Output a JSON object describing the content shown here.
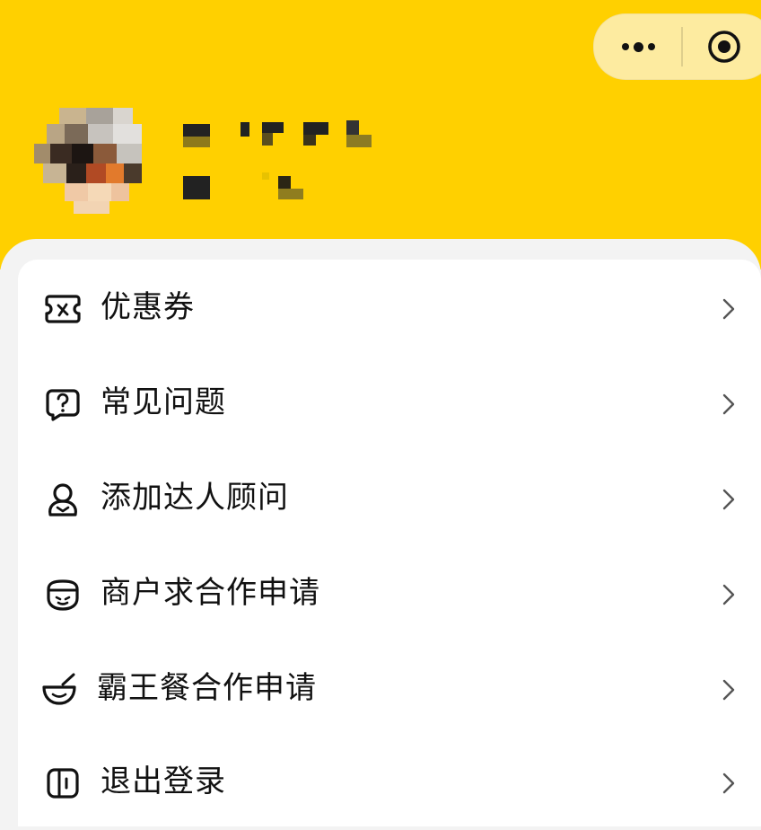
{
  "header": {
    "background_color": "#ffd000",
    "capsule": {
      "more_icon": "more-dots-icon",
      "close_icon": "target-close-icon"
    },
    "avatar_icon": "user-avatar-pixelated",
    "name_redacted": true
  },
  "menu": {
    "items": [
      {
        "label": "优惠券",
        "icon": "coupon-icon"
      },
      {
        "label": "常见问题",
        "icon": "question-bubble-icon"
      },
      {
        "label": "添加达人顾问",
        "icon": "advisor-person-icon"
      },
      {
        "label": "商户求合作申请",
        "icon": "merchant-face-icon"
      },
      {
        "label": "霸王餐合作申请",
        "icon": "meal-bowl-icon"
      },
      {
        "label": "退出登录",
        "icon": "logout-icon"
      }
    ],
    "chevron_icon": "chevron-right-icon"
  }
}
